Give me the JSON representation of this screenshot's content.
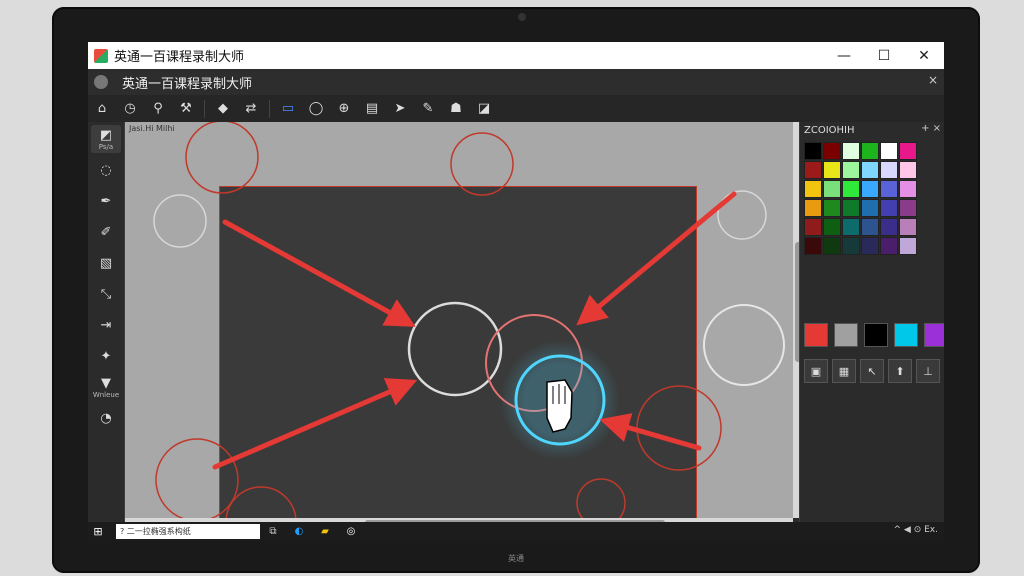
{
  "window": {
    "title": "英通一百课程录制大师",
    "controls": [
      "—",
      "☐",
      "✕"
    ]
  },
  "menu": {
    "title": "英通一百课程录制大师",
    "close": "×"
  },
  "toolbar": {
    "icons": [
      "home-icon",
      "clock-icon",
      "magnifier-icon",
      "hammer-icon",
      "shape-icon",
      "transform-icon",
      "select-rect-icon",
      "lasso-icon",
      "zoom-icon",
      "book-icon",
      "arrow-icon",
      "paint-icon",
      "crowd-icon",
      "eraser-icon"
    ]
  },
  "left_tools": [
    {
      "icon": "select-icon",
      "label": "Ps/a"
    },
    {
      "icon": "lasso-icon",
      "label": ""
    },
    {
      "icon": "pen-icon",
      "label": ""
    },
    {
      "icon": "brush-icon",
      "label": ""
    },
    {
      "icon": "fill-icon",
      "label": ""
    },
    {
      "icon": "line-icon",
      "label": ""
    },
    {
      "icon": "arrow-tool-icon",
      "label": ""
    },
    {
      "icon": "star-icon",
      "label": ""
    },
    {
      "icon": "cone-icon",
      "label": "Wnleue"
    },
    {
      "icon": "clock-tool-icon",
      "label": ""
    }
  ],
  "canvas": {
    "tab_label": "Jasi.Hi Milhi"
  },
  "right_panel": {
    "header": "ZCOIOHIH",
    "actions": "+ ×",
    "swatches": [
      "#000000",
      "#7a0000",
      "#e0ffe0",
      "#1db31d",
      "#ffffff",
      "#e8188a",
      "#9b1b1b",
      "#e8e41a",
      "#9df59d",
      "#7fd6ff",
      "#d8d8ff",
      "#ffc6e8",
      "#f0c40f",
      "#7ae07a",
      "#2ee83a",
      "#38a9ff",
      "#5a62d8",
      "#e38fe3",
      "#e89b0f",
      "#1e8a1e",
      "#0f7a2a",
      "#1f6fae",
      "#433fb0",
      "#8a3b8a",
      "#8f1b1b",
      "#0f5f12",
      "#0d6b6b",
      "#2d548f",
      "#3a2e8a",
      "#b87fb8",
      "#3a0a0a",
      "#0f3a0f",
      "#163a3a",
      "#2a2a5a",
      "#4a1e6a",
      "#bfa8d8"
    ],
    "chips": [
      "#e53935",
      "#a0a0a0",
      "#000000",
      "#00c8e8",
      "#9b30d8"
    ],
    "bottom_tools": [
      "image-icon",
      "grid-icon",
      "pointer-icon",
      "up-arrow-icon",
      "pin-icon"
    ]
  },
  "taskbar": {
    "search_text": "? 二一拉椭强系构纸",
    "tray_text": "^ ◀ ⊙ Ex."
  },
  "bezel_label": "英通"
}
